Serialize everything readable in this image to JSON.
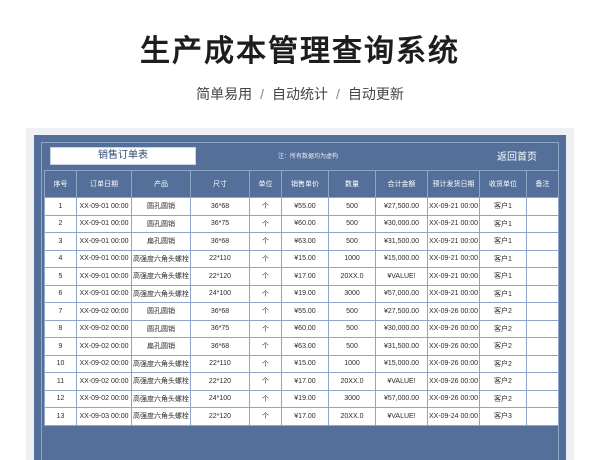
{
  "page": {
    "title": "生产成本管理查询系统",
    "subtitle_parts": [
      "简单易用",
      "自动统计",
      "自动更新"
    ],
    "separator": "/"
  },
  "sheet": {
    "title_box": "销售订单表",
    "note": "注：所有数据均为虚构",
    "back_label": "返回首页",
    "colors": {
      "frame": "#54709a",
      "grid_line": "#8fa6c6",
      "title_text": "#2e4a74"
    },
    "columns": [
      "序号",
      "订单日期",
      "产品",
      "尺寸",
      "单位",
      "销售单价",
      "数量",
      "合计金额",
      "预计发货日期",
      "收货单位",
      "备注"
    ],
    "rows": [
      [
        "1",
        "XX-09-01 00:00",
        "圆孔圆销",
        "36*68",
        "个",
        "¥55.00",
        "500",
        "¥27,500.00",
        "XX-09-21 00:00",
        "客户1",
        ""
      ],
      [
        "2",
        "XX-09-01 00:00",
        "圆孔圆销",
        "36*75",
        "个",
        "¥60.00",
        "500",
        "¥30,000.00",
        "XX-09-21 00:00",
        "客户1",
        ""
      ],
      [
        "3",
        "XX-09-01 00:00",
        "扁孔圆销",
        "36*68",
        "个",
        "¥63.00",
        "500",
        "¥31,500.00",
        "XX-09-21 00:00",
        "客户1",
        ""
      ],
      [
        "4",
        "XX-09-01 00:00",
        "高强度六角头螺栓",
        "22*110",
        "个",
        "¥15.00",
        "1000",
        "¥15,000.00",
        "XX-09-21 00:00",
        "客户1",
        ""
      ],
      [
        "5",
        "XX-09-01 00:00",
        "高强度六角头螺栓",
        "22*120",
        "个",
        "¥17.00",
        "20XX.0",
        "¥VALUE!",
        "XX-09-21 00:00",
        "客户1",
        ""
      ],
      [
        "6",
        "XX-09-01 00:00",
        "高强度六角头螺栓",
        "24*100",
        "个",
        "¥19.00",
        "3000",
        "¥57,000.00",
        "XX-09-21 00:00",
        "客户1",
        ""
      ],
      [
        "7",
        "XX-09-02 00:00",
        "圆孔圆销",
        "36*68",
        "个",
        "¥55.00",
        "500",
        "¥27,500.00",
        "XX-09-26 00:00",
        "客户2",
        ""
      ],
      [
        "8",
        "XX-09-02 00:00",
        "圆孔圆销",
        "36*75",
        "个",
        "¥60.00",
        "500",
        "¥30,000.00",
        "XX-09-26 00:00",
        "客户2",
        ""
      ],
      [
        "9",
        "XX-09-02 00:00",
        "扁孔圆销",
        "36*68",
        "个",
        "¥63.00",
        "500",
        "¥31,500.00",
        "XX-09-26 00:00",
        "客户2",
        ""
      ],
      [
        "10",
        "XX-09-02 00:00",
        "高强度六角头螺栓",
        "22*110",
        "个",
        "¥15.00",
        "1000",
        "¥15,000.00",
        "XX-09-26 00:00",
        "客户2",
        ""
      ],
      [
        "11",
        "XX-09-02 00:00",
        "高强度六角头螺栓",
        "22*120",
        "个",
        "¥17.00",
        "20XX.0",
        "¥VALUE!",
        "XX-09-26 00:00",
        "客户2",
        ""
      ],
      [
        "12",
        "XX-09-02 00:00",
        "高强度六角头螺栓",
        "24*100",
        "个",
        "¥19.00",
        "3000",
        "¥57,000.00",
        "XX-09-26 00:00",
        "客户2",
        ""
      ],
      [
        "13",
        "XX-09-03 00:00",
        "高强度六角头螺栓",
        "22*120",
        "个",
        "¥17.00",
        "20XX.0",
        "¥VALUE!",
        "XX-09-24 00:00",
        "客户3",
        ""
      ]
    ]
  }
}
